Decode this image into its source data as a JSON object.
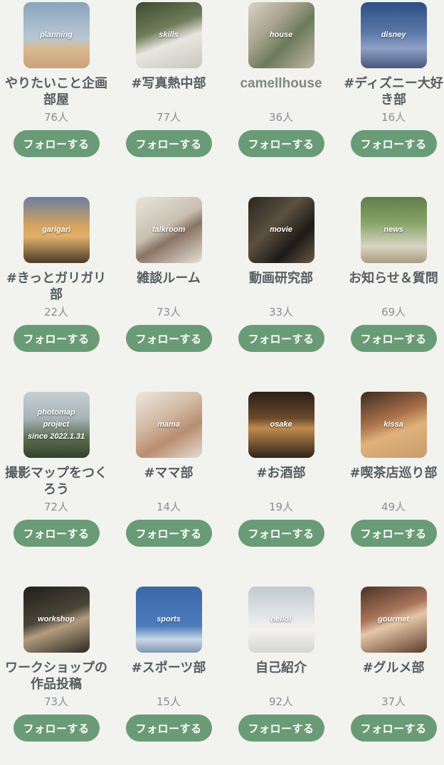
{
  "communities": [
    {
      "tag": "planning",
      "name": "やりたいこと企画部屋",
      "count": "76人",
      "follow_label": "フォローする"
    },
    {
      "tag": "skills",
      "name": "#写真熱中部",
      "count": "77人",
      "follow_label": "フォローする"
    },
    {
      "tag": "house",
      "name": "camellhouse",
      "count": "36人",
      "follow_label": "フォローする"
    },
    {
      "tag": "disney",
      "name": "#ディズニー大好き部",
      "count": "16人",
      "follow_label": "フォローする"
    },
    {
      "tag": "garigari",
      "name": "#きっとガリガリ部",
      "count": "22人",
      "follow_label": "フォローする"
    },
    {
      "tag": "talkroom",
      "name": "雑談ルーム",
      "count": "73人",
      "follow_label": "フォローする"
    },
    {
      "tag": "movie",
      "name": "動画研究部",
      "count": "33人",
      "follow_label": "フォローする"
    },
    {
      "tag": "news",
      "name": "お知らせ＆質問",
      "count": "69人",
      "follow_label": "フォローする"
    },
    {
      "tag": "photomap\nproject\nsince 2022.1.31",
      "name": "撮影マップをつくろう",
      "count": "72人",
      "follow_label": "フォローする"
    },
    {
      "tag": "mama",
      "name": "#ママ部",
      "count": "14人",
      "follow_label": "フォローする"
    },
    {
      "tag": "osake",
      "name": "#お酒部",
      "count": "19人",
      "follow_label": "フォローする"
    },
    {
      "tag": "kissa",
      "name": "#喫茶店巡り部",
      "count": "49人",
      "follow_label": "フォローする"
    },
    {
      "tag": "workshop",
      "name": "ワークショップの作品投稿",
      "count": "73人",
      "follow_label": "フォローする"
    },
    {
      "tag": "sports",
      "name": "#スポーツ部",
      "count": "15人",
      "follow_label": "フォローする"
    },
    {
      "tag": "hello!",
      "name": "自己紹介",
      "count": "92人",
      "follow_label": "フォローする"
    },
    {
      "tag": "gourmet",
      "name": "#グルメ部",
      "count": "37人",
      "follow_label": "フォローする"
    }
  ],
  "colors": {
    "background": "#f2f2ee",
    "follow_button": "#6a9b77",
    "name_text": "#555d61",
    "count_text": "#8a8f93"
  }
}
